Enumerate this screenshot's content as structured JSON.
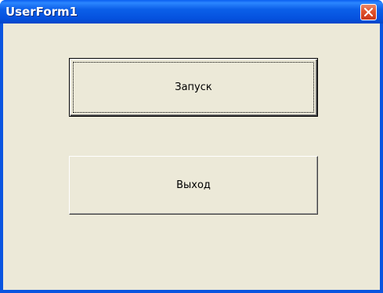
{
  "window": {
    "title": "UserForm1"
  },
  "buttons": {
    "start_label": "Запуск",
    "exit_label": "Выход"
  },
  "colors": {
    "titlebar": "#0a55e0",
    "client_background": "#ece9d8",
    "close_button": "#e0532c"
  },
  "icons": {
    "close": "close-icon"
  }
}
